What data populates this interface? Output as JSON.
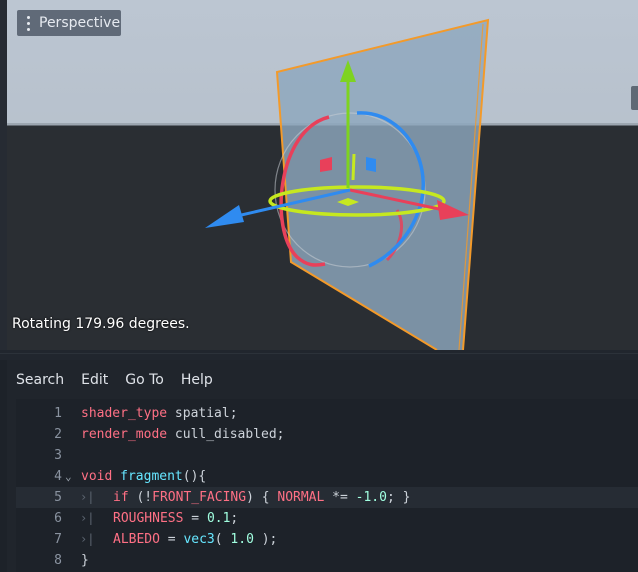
{
  "viewport": {
    "perspective_label": "Perspective",
    "status_text": "Rotating 179.96 degrees."
  },
  "menu": [
    "Search",
    "Edit",
    "Go To",
    "Help"
  ],
  "code_lines": [
    {
      "n": "1",
      "tokens": [
        {
          "t": "shader_type",
          "c": "kw"
        },
        {
          "t": " spatial;",
          "c": "txt"
        }
      ]
    },
    {
      "n": "2",
      "tokens": [
        {
          "t": "render_mode",
          "c": "kw"
        },
        {
          "t": " cull_disabled;",
          "c": "txt"
        }
      ]
    },
    {
      "n": "3",
      "tokens": []
    },
    {
      "n": "4",
      "fold": "v",
      "tokens": [
        {
          "t": "void",
          "c": "kw"
        },
        {
          "t": " ",
          "c": "txt"
        },
        {
          "t": "fragment",
          "c": "fn"
        },
        {
          "t": "(){",
          "c": "txt"
        }
      ]
    },
    {
      "n": "5",
      "active": true,
      "indent": true,
      "tokens": [
        {
          "t": "if",
          "c": "kw"
        },
        {
          "t": " (!",
          "c": "txt"
        },
        {
          "t": "FRONT_FACING",
          "c": "builtin"
        },
        {
          "t": ") { ",
          "c": "txt"
        },
        {
          "t": "NORMAL",
          "c": "builtin"
        },
        {
          "t": " *= ",
          "c": "txt"
        },
        {
          "t": "-1.0",
          "c": "num"
        },
        {
          "t": "; }",
          "c": "txt"
        }
      ]
    },
    {
      "n": "6",
      "indent": true,
      "tokens": [
        {
          "t": "ROUGHNESS",
          "c": "builtin"
        },
        {
          "t": " = ",
          "c": "txt"
        },
        {
          "t": "0.1",
          "c": "num"
        },
        {
          "t": ";",
          "c": "txt"
        }
      ]
    },
    {
      "n": "7",
      "indent": true,
      "tokens": [
        {
          "t": "ALBEDO",
          "c": "builtin"
        },
        {
          "t": " = ",
          "c": "txt"
        },
        {
          "t": "vec3",
          "c": "fn"
        },
        {
          "t": "( ",
          "c": "txt"
        },
        {
          "t": "1.0",
          "c": "num"
        },
        {
          "t": " );",
          "c": "txt"
        }
      ]
    },
    {
      "n": "8",
      "tokens": [
        {
          "t": "}",
          "c": "txt"
        }
      ]
    }
  ],
  "colors": {
    "x_axis": "#e8405a",
    "y_axis": "#7ed321",
    "z_axis": "#2f8bf0",
    "selection": "#f39a2a",
    "plane": "#8ea7bd"
  }
}
